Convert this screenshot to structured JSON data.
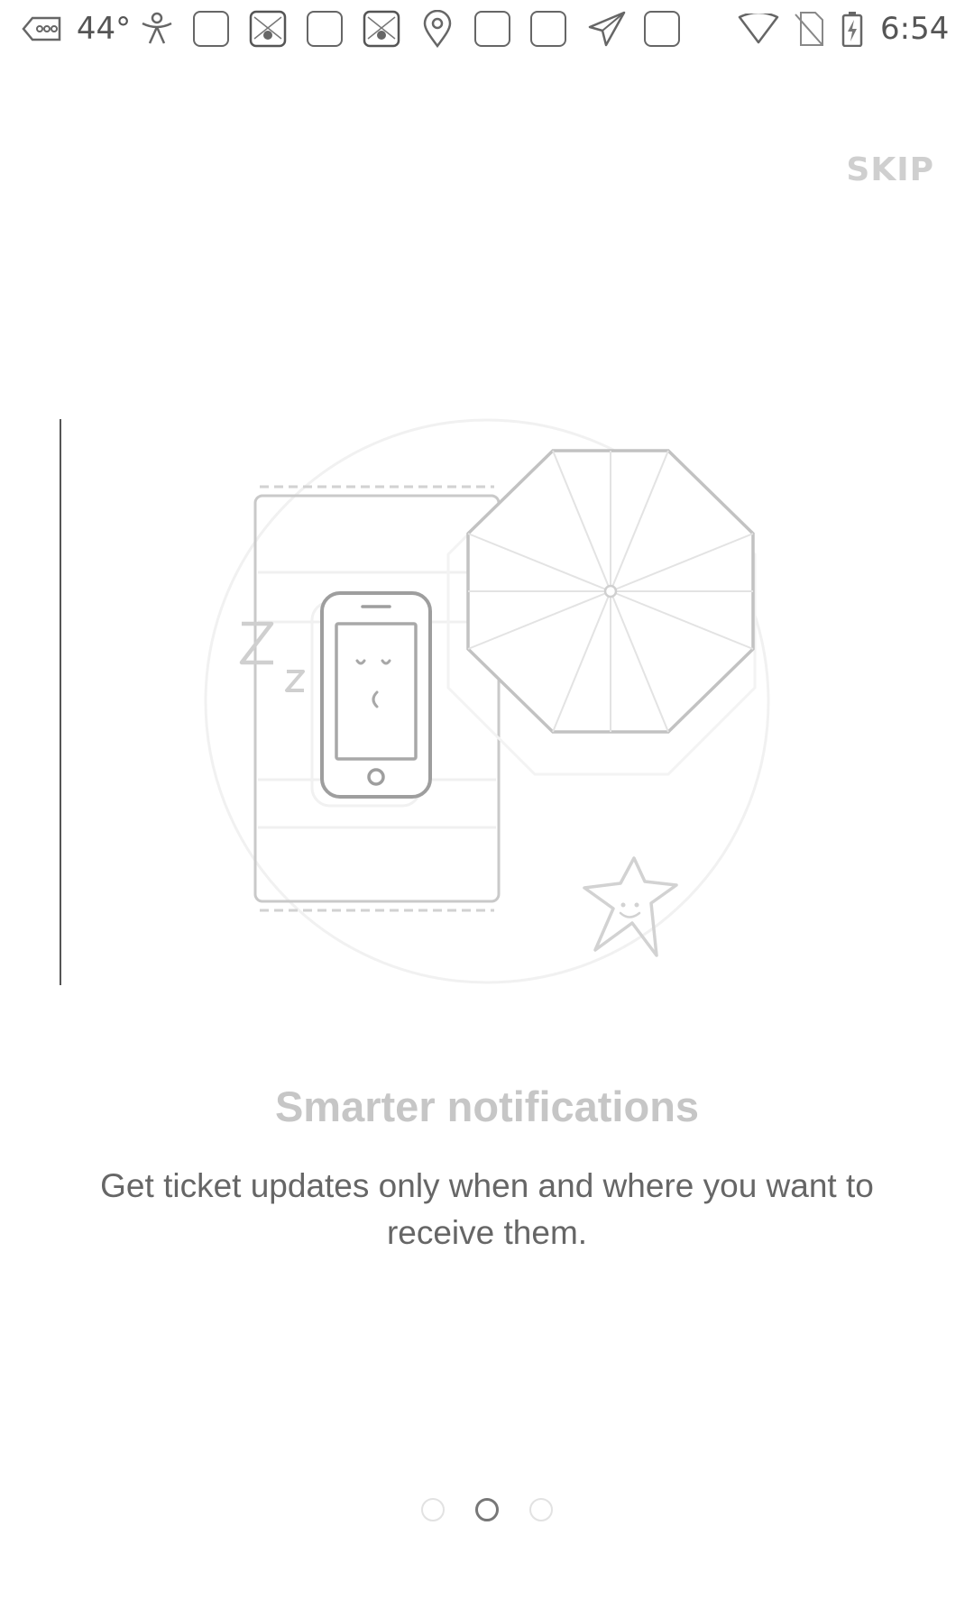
{
  "status_bar": {
    "temperature": "44°",
    "time": "6:54",
    "icons": [
      "message-tag-icon",
      "accessibility-person-icon",
      "app-square-icon",
      "photo-gallery-icon",
      "app-square-icon",
      "photo-gallery-icon",
      "location-pin-icon",
      "app-square-icon",
      "app-square-icon",
      "send-plane-icon",
      "app-square-icon",
      "wifi-icon",
      "no-sim-icon",
      "battery-charging-icon"
    ]
  },
  "onboarding": {
    "skip_label": "SKIP",
    "title": "Smarter notifications",
    "description": "Get ticket updates only when and where you want to receive them.",
    "pages_total": 3,
    "active_page": 2
  },
  "colors": {
    "background": "#ffffff",
    "title": "#c6c6c6",
    "body": "#666666",
    "illustration_stroke": "#bdbdbd",
    "dot_active": "#777777",
    "dot_inactive": "#e2e2e2"
  }
}
